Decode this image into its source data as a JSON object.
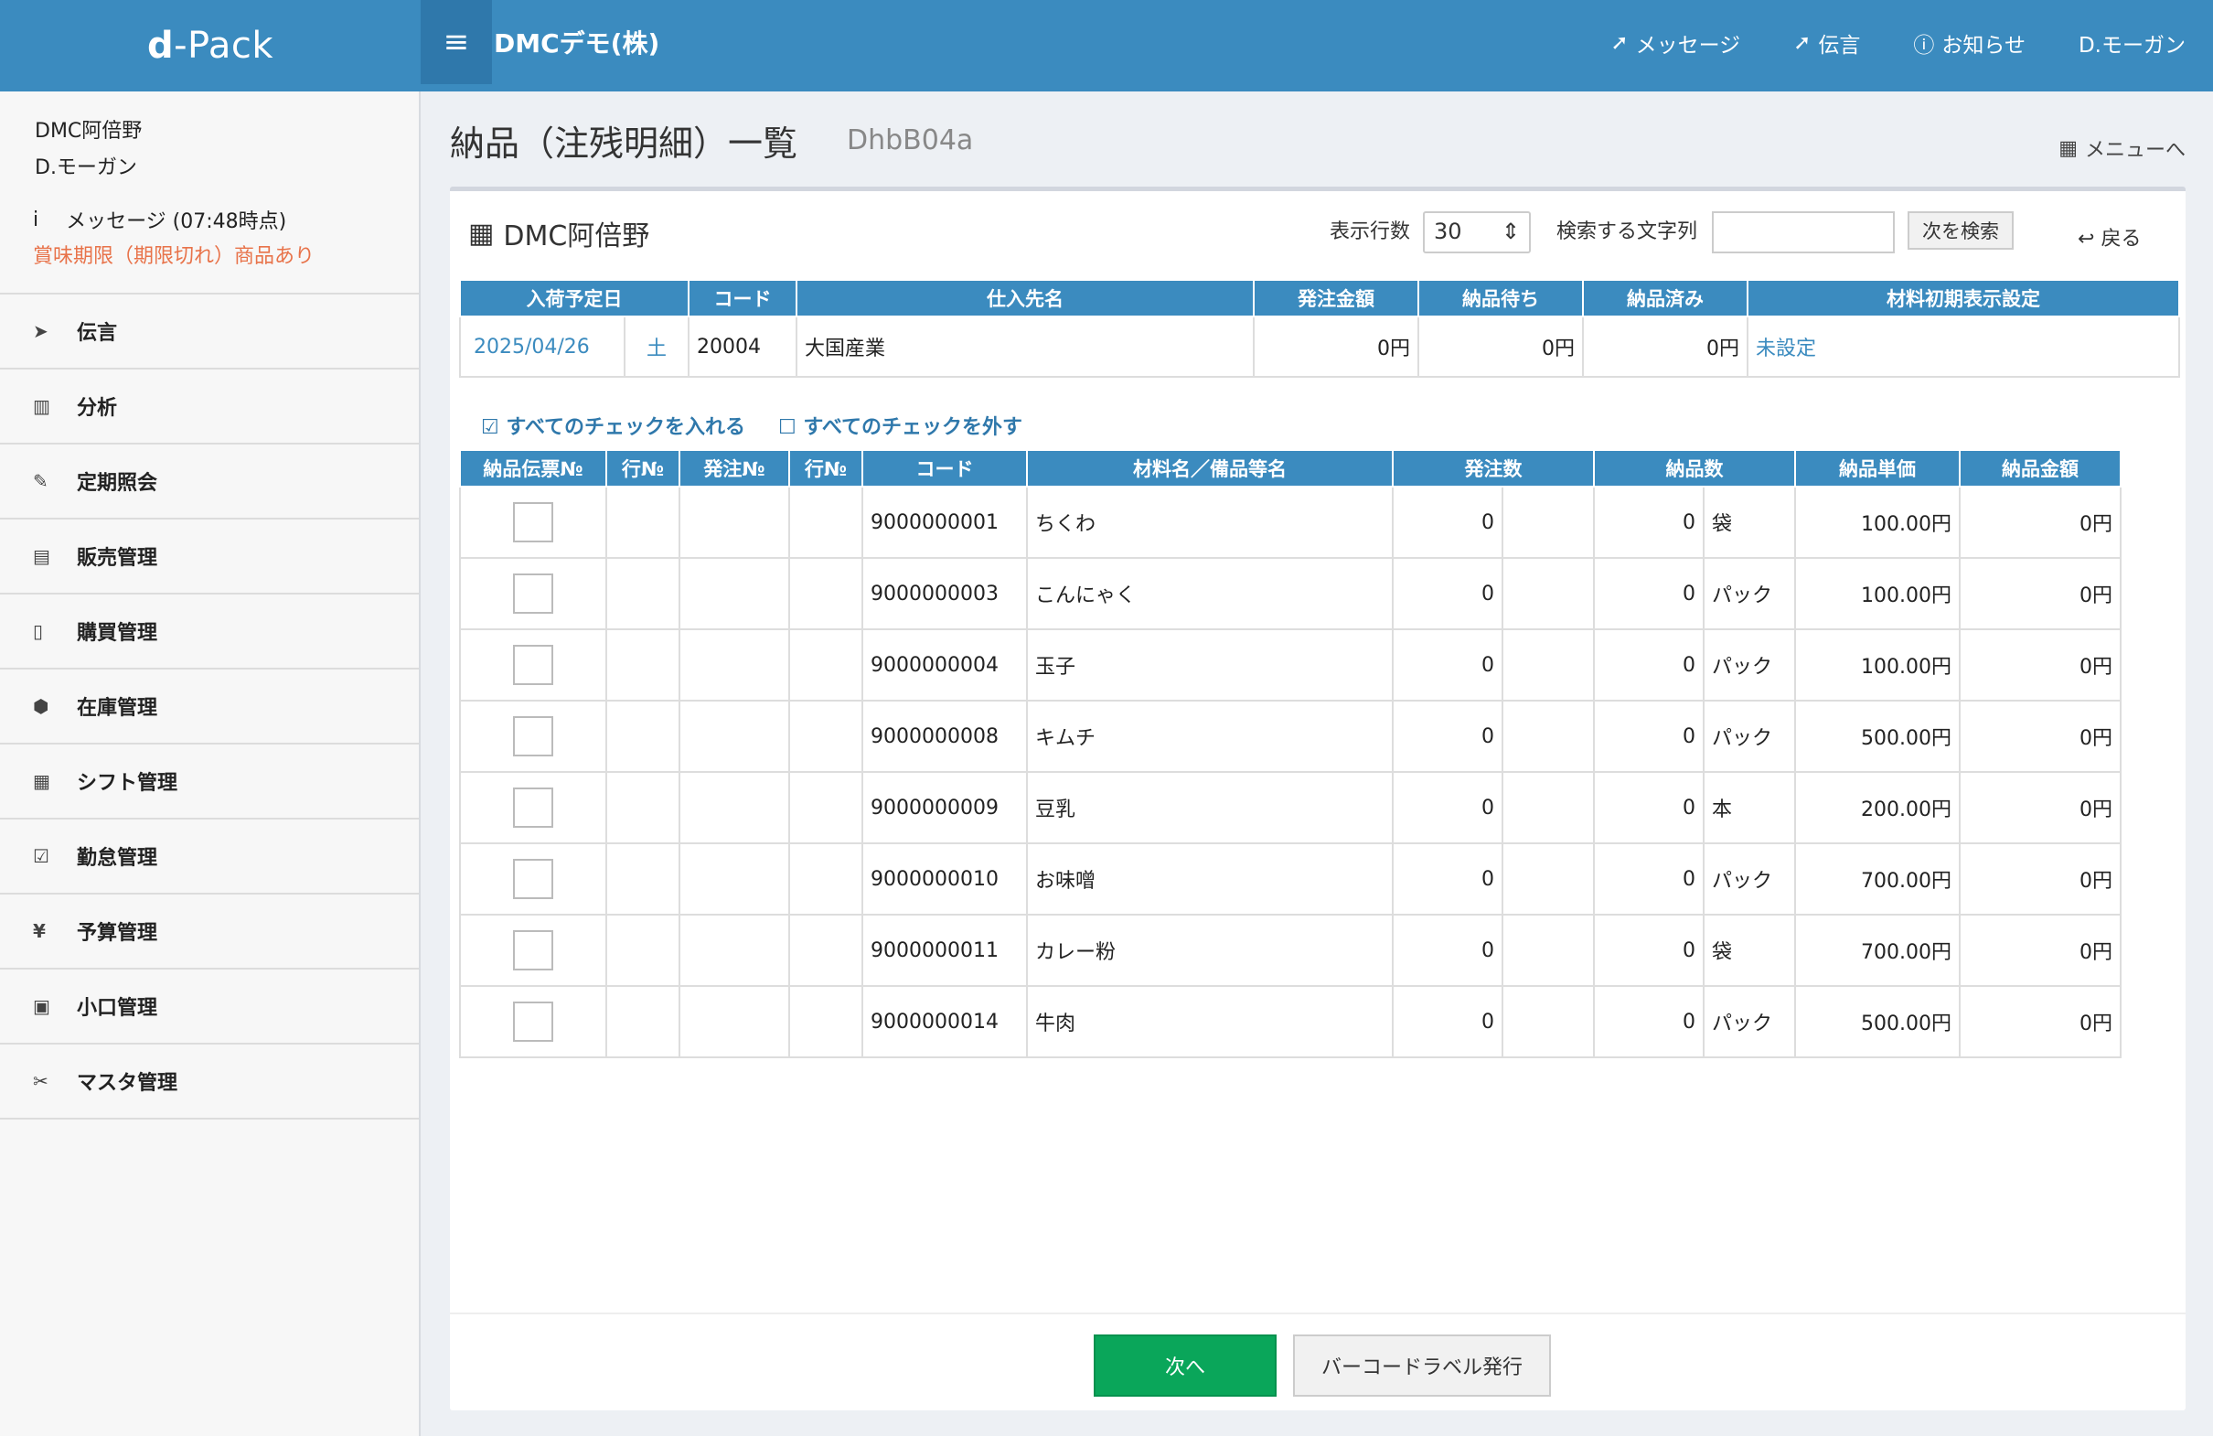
{
  "brand": {
    "prefix": "d",
    "rest": "-Pack"
  },
  "header": {
    "company": "DMCデモ(株)",
    "nav": [
      {
        "label": "メッセージ",
        "icon": "paper-plane-icon"
      },
      {
        "label": "伝言",
        "icon": "paper-plane-icon"
      },
      {
        "label": "お知らせ",
        "icon": "info-icon"
      },
      {
        "label": "D.モーガン",
        "icon": ""
      }
    ]
  },
  "sidebar": {
    "store": "DMC阿倍野",
    "user": "D.モーガン",
    "message": "メッセージ (07:48時点)",
    "warning": "賞味期限（期限切れ）商品あり",
    "items": [
      {
        "label": "伝言",
        "icon": "paper-plane-icon"
      },
      {
        "label": "分析",
        "icon": "bar-chart-icon"
      },
      {
        "label": "定期照会",
        "icon": "edit-icon"
      },
      {
        "label": "販売管理",
        "icon": "fax-icon"
      },
      {
        "label": "購買管理",
        "icon": "document-icon"
      },
      {
        "label": "在庫管理",
        "icon": "cubes-icon"
      },
      {
        "label": "シフト管理",
        "icon": "calendar-icon"
      },
      {
        "label": "勤怠管理",
        "icon": "calendar-check-icon"
      },
      {
        "label": "予算管理",
        "icon": "yen-icon"
      },
      {
        "label": "小口管理",
        "icon": "briefcase-icon"
      },
      {
        "label": "マスタ管理",
        "icon": "wrench-icon"
      }
    ]
  },
  "page": {
    "title": "納品（注残明細）一覧",
    "code": "DhbB04a",
    "menu_link": "メニューへ"
  },
  "panel": {
    "store": "DMC阿倍野",
    "rows_label": "表示行数",
    "rows_value": "30",
    "search_label": "検索する文字列",
    "search_placeholder": "",
    "search_button": "次を検索",
    "back": "戻る"
  },
  "summary": {
    "headers": [
      "入荷予定日",
      "コード",
      "仕入先名",
      "発注金額",
      "納品待ち",
      "納品済み",
      "材料初期表示設定"
    ],
    "row": {
      "date": "2025/04/26",
      "weekday": "土",
      "code": "20004",
      "supplier": "大国産業",
      "order_amount": "0円",
      "waiting": "0円",
      "delivered": "0円",
      "setting": "未設定"
    }
  },
  "checks": {
    "check_all": "すべてのチェックを入れる",
    "uncheck_all": "すべてのチェックを外す"
  },
  "items": {
    "headers": [
      "納品伝票№",
      "行№",
      "発注№",
      "行№",
      "コード",
      "材料名／備品等名",
      "発注数",
      "納品数",
      "納品単価",
      "納品金額"
    ],
    "rows": [
      {
        "code": "9000000001",
        "name": "ちくわ",
        "order_qty": "0",
        "deliv_qty": "0",
        "unit": "袋",
        "price": "100.00円",
        "amount": "0円"
      },
      {
        "code": "9000000003",
        "name": "こんにゃく",
        "order_qty": "0",
        "deliv_qty": "0",
        "unit": "パック",
        "price": "100.00円",
        "amount": "0円"
      },
      {
        "code": "9000000004",
        "name": "玉子",
        "order_qty": "0",
        "deliv_qty": "0",
        "unit": "パック",
        "price": "100.00円",
        "amount": "0円"
      },
      {
        "code": "9000000008",
        "name": "キムチ",
        "order_qty": "0",
        "deliv_qty": "0",
        "unit": "パック",
        "price": "500.00円",
        "amount": "0円"
      },
      {
        "code": "9000000009",
        "name": "豆乳",
        "order_qty": "0",
        "deliv_qty": "0",
        "unit": "本",
        "price": "200.00円",
        "amount": "0円"
      },
      {
        "code": "9000000010",
        "name": "お味噌",
        "order_qty": "0",
        "deliv_qty": "0",
        "unit": "パック",
        "price": "700.00円",
        "amount": "0円"
      },
      {
        "code": "9000000011",
        "name": "カレー粉",
        "order_qty": "0",
        "deliv_qty": "0",
        "unit": "袋",
        "price": "700.00円",
        "amount": "0円"
      },
      {
        "code": "9000000014",
        "name": "牛肉",
        "order_qty": "0",
        "deliv_qty": "0",
        "unit": "パック",
        "price": "500.00円",
        "amount": "0円"
      }
    ]
  },
  "buttons": {
    "next": "次へ",
    "barcode": "バーコードラベル発行"
  }
}
